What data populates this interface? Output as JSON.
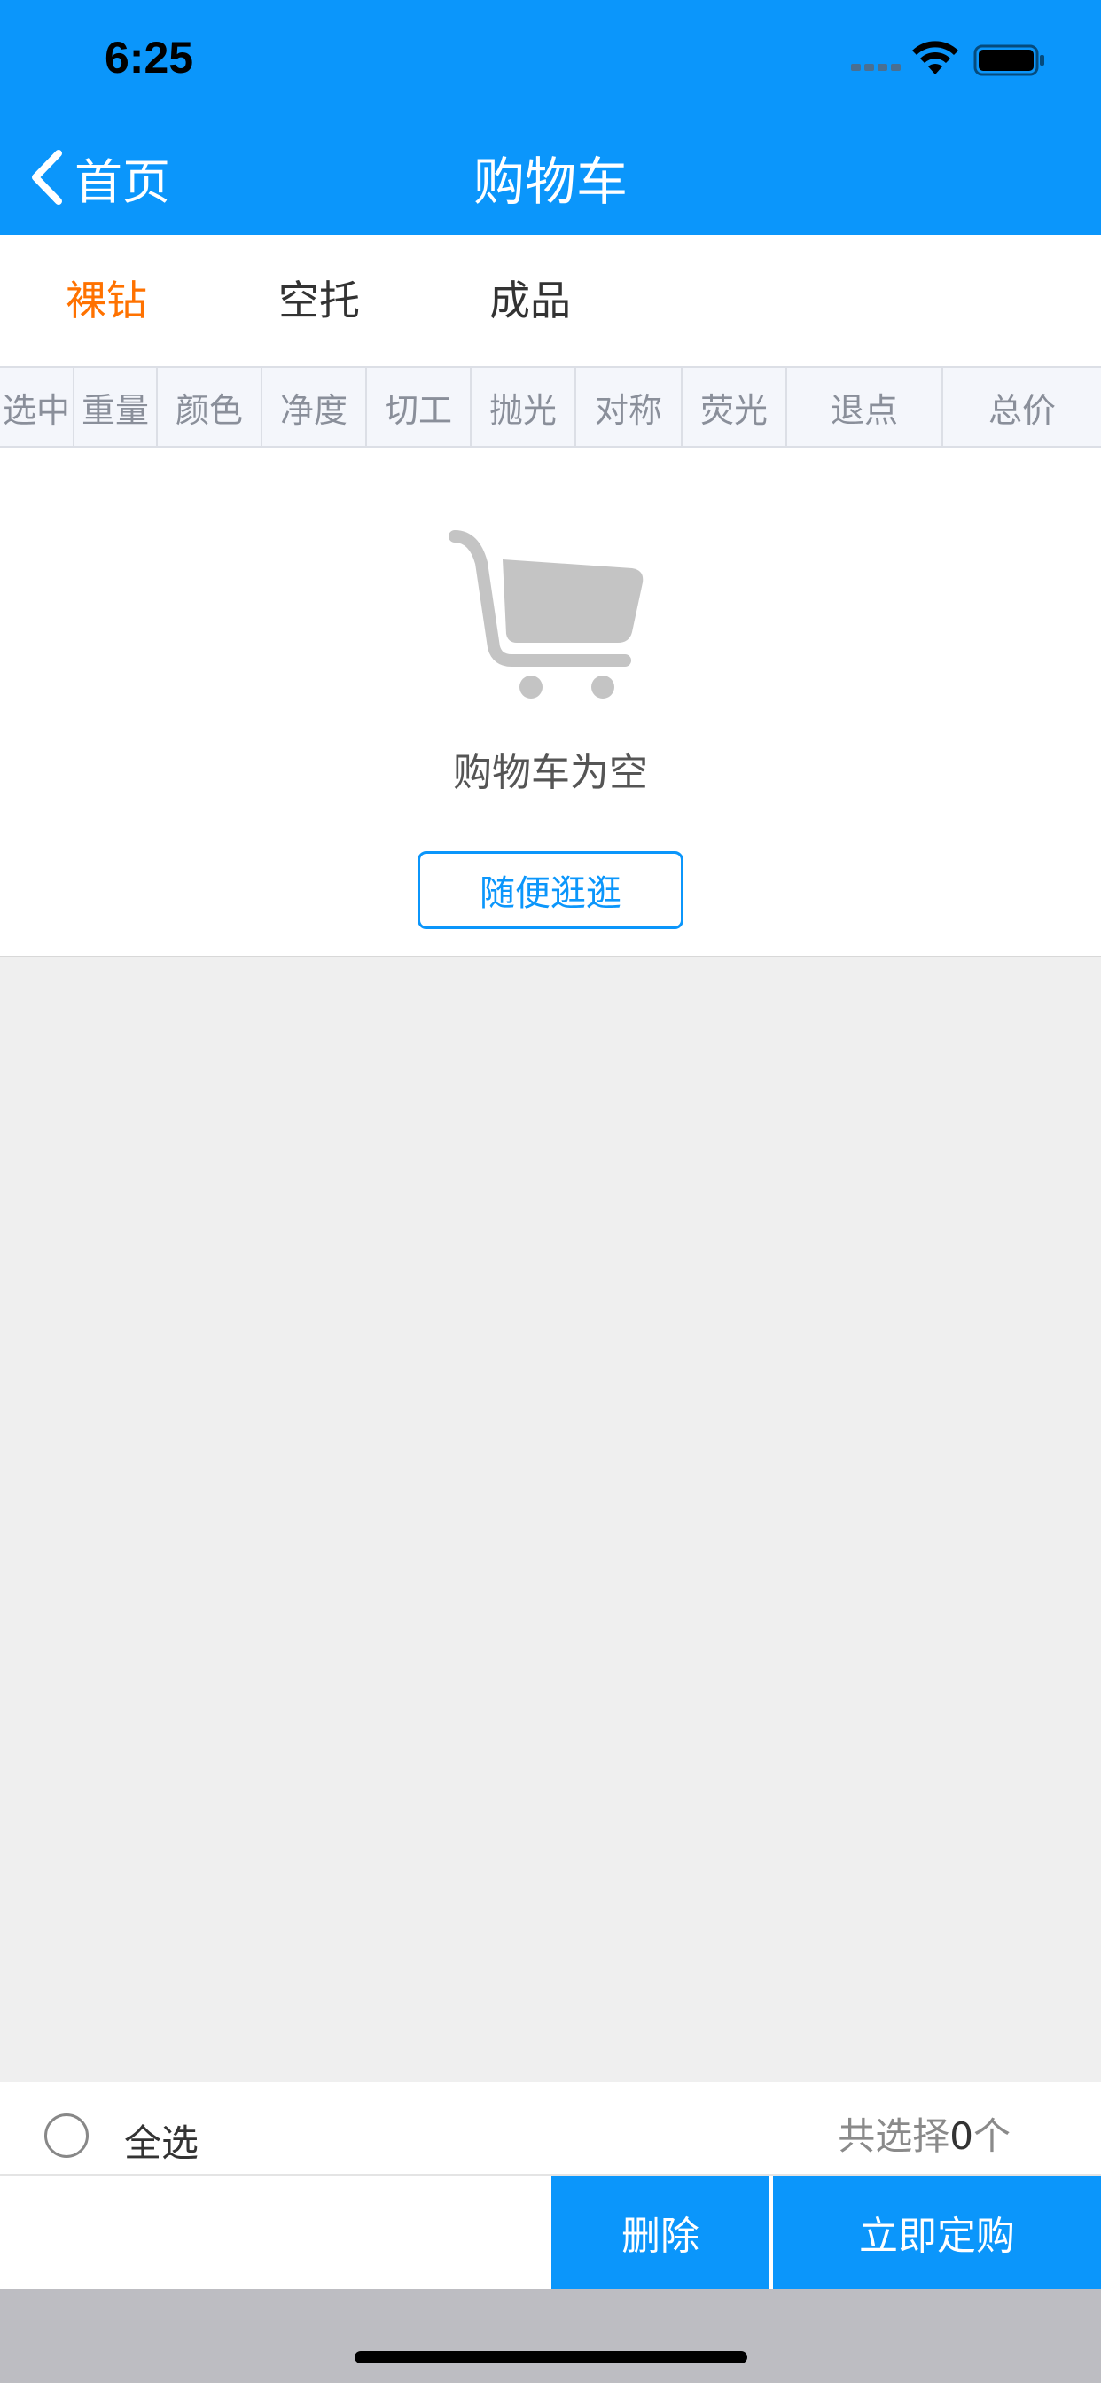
{
  "status_bar": {
    "time": "6:25"
  },
  "nav": {
    "back_label": "首页",
    "title": "购物车"
  },
  "tabs": [
    {
      "label": "裸钻",
      "active": true
    },
    {
      "label": "空托",
      "active": false
    },
    {
      "label": "成品",
      "active": false
    }
  ],
  "table": {
    "columns": [
      "选中",
      "重量",
      "颜色",
      "净度",
      "切工",
      "抛光",
      "对称",
      "荧光",
      "退点",
      "总价"
    ]
  },
  "empty_state": {
    "icon": "cart-icon",
    "message": "购物车为空",
    "button_label": "随便逛逛"
  },
  "footer": {
    "select_all_label": "全选",
    "count_prefix": "共选择",
    "count_value": "0",
    "count_suffix": "个",
    "delete_label": "删除",
    "order_label": "立即定购"
  },
  "colors": {
    "primary": "#0b96fb",
    "active_tab": "#ff7200",
    "background": "#efefef"
  }
}
